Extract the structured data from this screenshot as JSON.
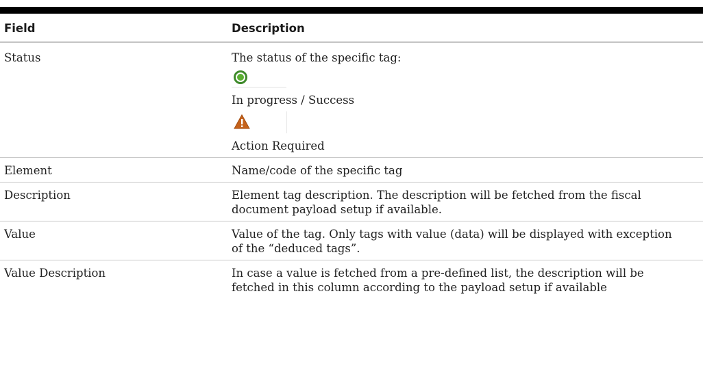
{
  "table": {
    "headers": {
      "field": "Field",
      "description": "Description"
    },
    "status_row": {
      "field": "Status",
      "intro": "The status of the specific tag:",
      "states": [
        {
          "icon": "success-circle-icon",
          "color": "#5aaf31",
          "label": "In progress / Success"
        },
        {
          "icon": "warning-triangle-icon",
          "color": "#c5621b",
          "label": "Action Required"
        }
      ]
    },
    "rows": [
      {
        "field": "Element",
        "description": "Name/code of the specific tag"
      },
      {
        "field": "Description",
        "description": "Element tag description. The description will be fetched from the fiscal document payload setup if available."
      },
      {
        "field": "Value",
        "description": "Value of the tag. Only tags with value (data) will be displayed with exception of the “deduced tags”."
      },
      {
        "field": "Value Description",
        "description": "In case a value is fetched from a pre-defined list, the description will be fetched in this column according to the payload setup if available"
      }
    ]
  }
}
